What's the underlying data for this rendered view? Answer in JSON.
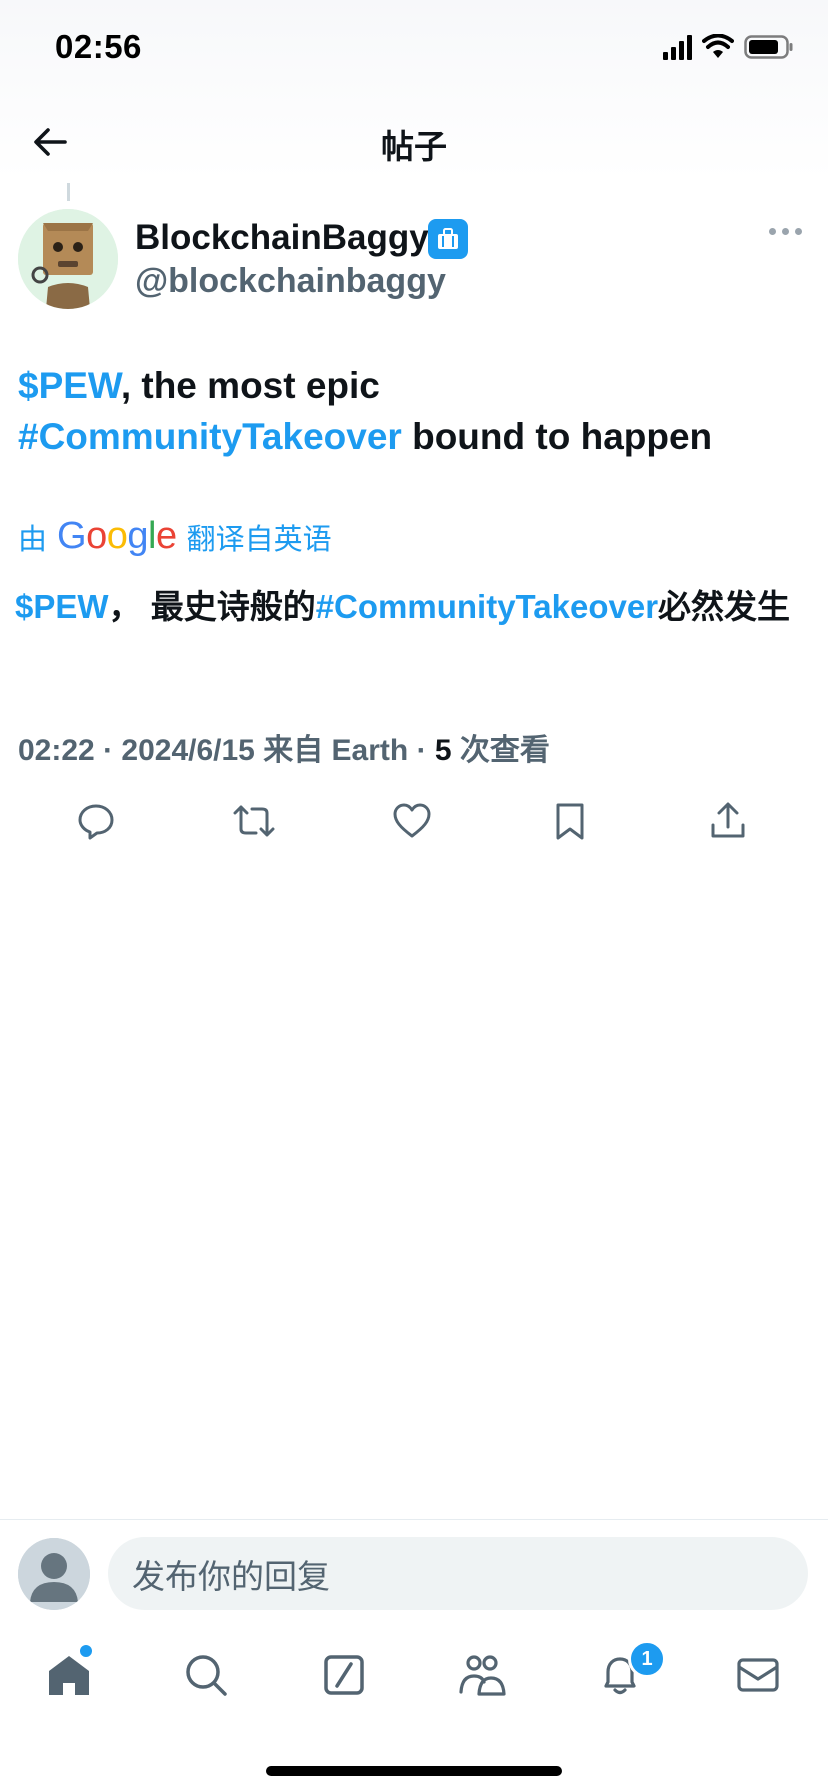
{
  "status_bar": {
    "time": "02:56"
  },
  "header": {
    "title": "帖子"
  },
  "post": {
    "author": {
      "name": "BlockchainBaggy",
      "handle": "@blockchainbaggy"
    },
    "text": {
      "cashtag": "$PEW",
      "part1": ", the most epic",
      "hashtag": "#CommunityTakeover",
      "part2": " bound to happen"
    },
    "translation": {
      "prefix": "由",
      "provider": "Google",
      "suffix": "翻译自英语",
      "cashtag": "$PEW",
      "part1": "， 最史诗般的",
      "hashtag": "#CommunityTakeover",
      "part2": "必然发生"
    },
    "meta": {
      "time": "02:22",
      "sep1": " · ",
      "date": "2024/6/15",
      "source": " 来自 Earth",
      "sep2": " · ",
      "views_count": "5",
      "views_label": " 次查看"
    }
  },
  "reply": {
    "placeholder": "发布你的回复"
  },
  "tabbar": {
    "notification_count": "1"
  },
  "colors": {
    "accent": "#1d9bf0",
    "text": "#0f1419",
    "secondary": "#536471"
  }
}
